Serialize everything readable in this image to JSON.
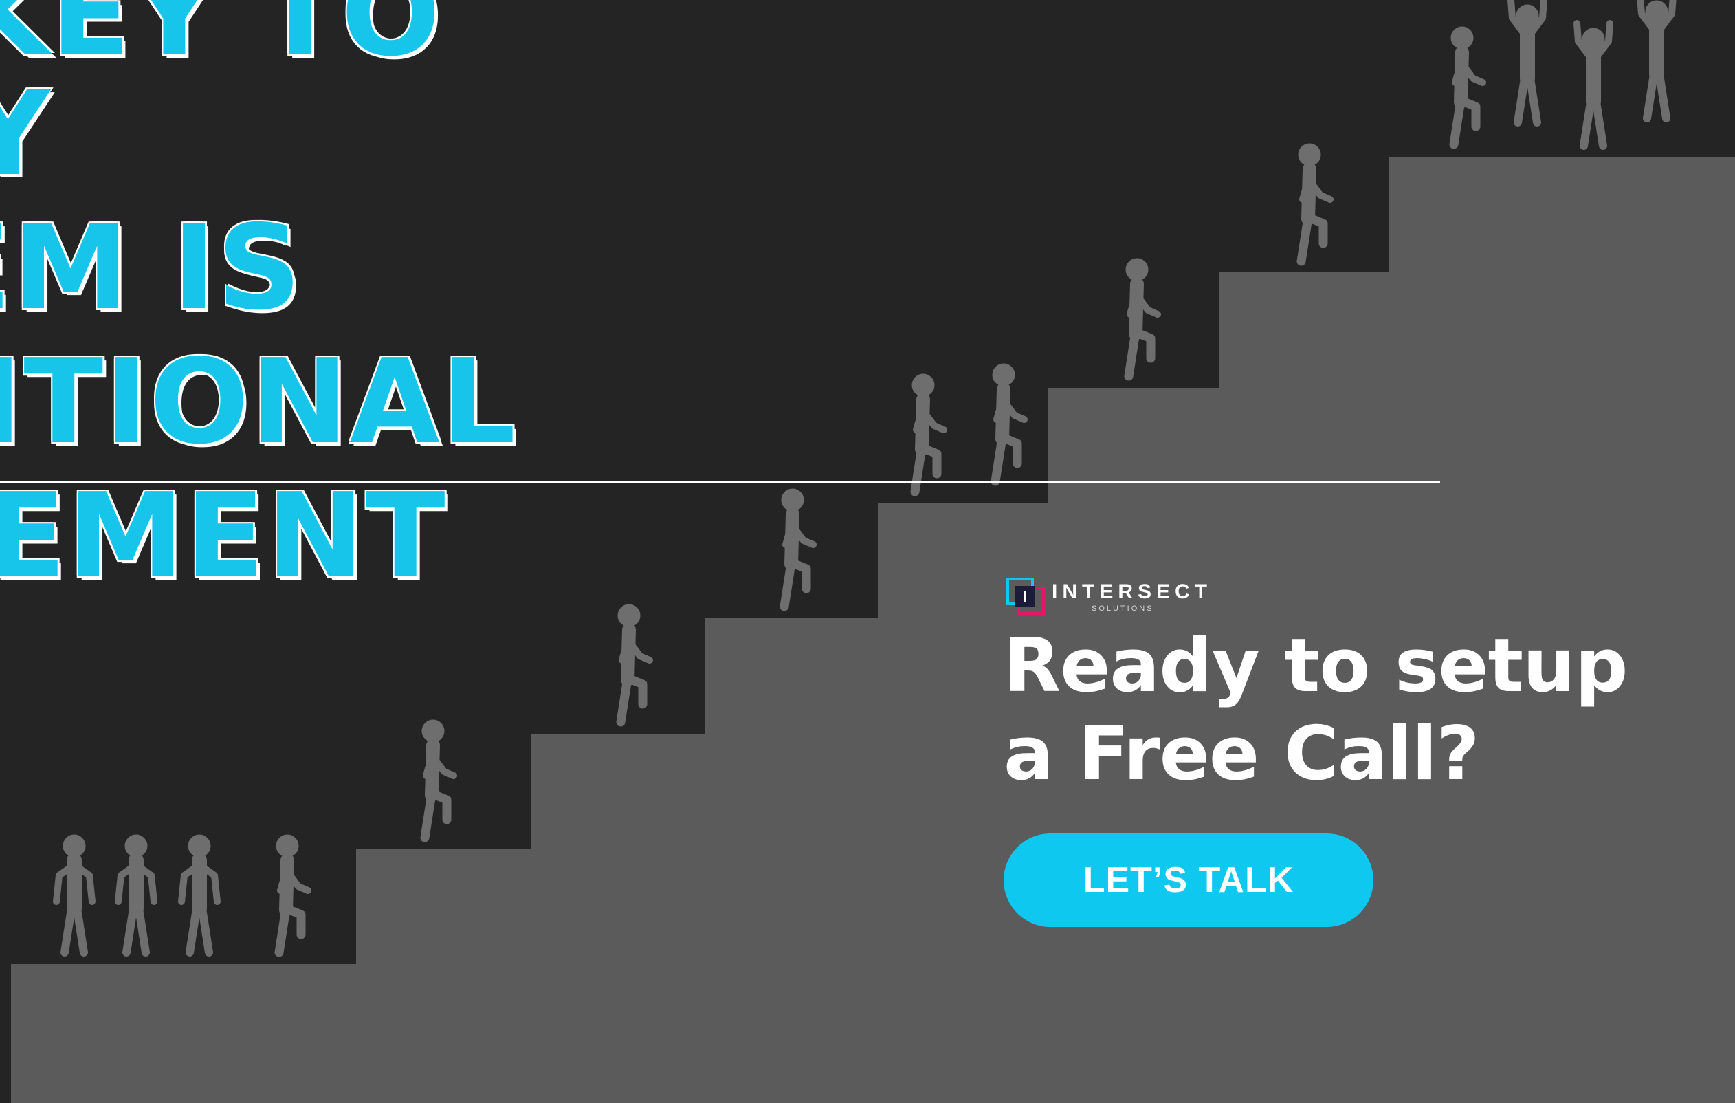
{
  "headline": {
    "lines": [
      "KEY TO",
      "Y",
      "EM IS",
      "NTIONAL",
      "EMENT"
    ]
  },
  "logo": {
    "name": "INTERSECT",
    "sub": "SOLUTIONS",
    "mark_letter": "I"
  },
  "cta": {
    "title_line1": "Ready to setup",
    "title_line2": "a Free Call?",
    "button_label": "LET’S TALK"
  },
  "colors": {
    "background": "#242424",
    "stairs": "#5b5b5b",
    "figures": "#6e6e6e",
    "accent": "#0fc8f0",
    "logo_pink": "#e0176b",
    "text": "#ffffff"
  },
  "icons": {
    "figure": "person-walking-icon",
    "figure_celebrating": "person-celebrating-icon",
    "figure_standing": "person-standing-icon"
  }
}
